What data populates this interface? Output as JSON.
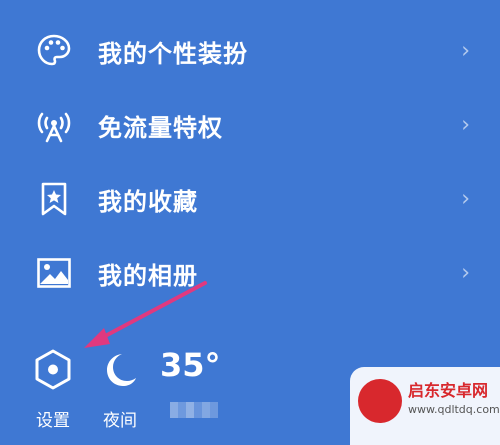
{
  "menu": {
    "items": [
      {
        "label": "我的个性装扮",
        "icon": "palette-icon"
      },
      {
        "label": "免流量特权",
        "icon": "broadcast-tower-icon"
      },
      {
        "label": "我的收藏",
        "icon": "bookmark-star-icon"
      },
      {
        "label": "我的相册",
        "icon": "photo-album-icon"
      }
    ],
    "chevron": "›"
  },
  "bottom": {
    "settings_label": "设置",
    "night_label": "夜间",
    "temperature": "35°"
  },
  "watermark": {
    "title": "启东安卓网",
    "url": "www.qdltdq.com"
  },
  "colors": {
    "background": "#3f78d3",
    "arrow": "#e0397f",
    "text": "#ffffff",
    "watermark_red": "#d8282d"
  }
}
